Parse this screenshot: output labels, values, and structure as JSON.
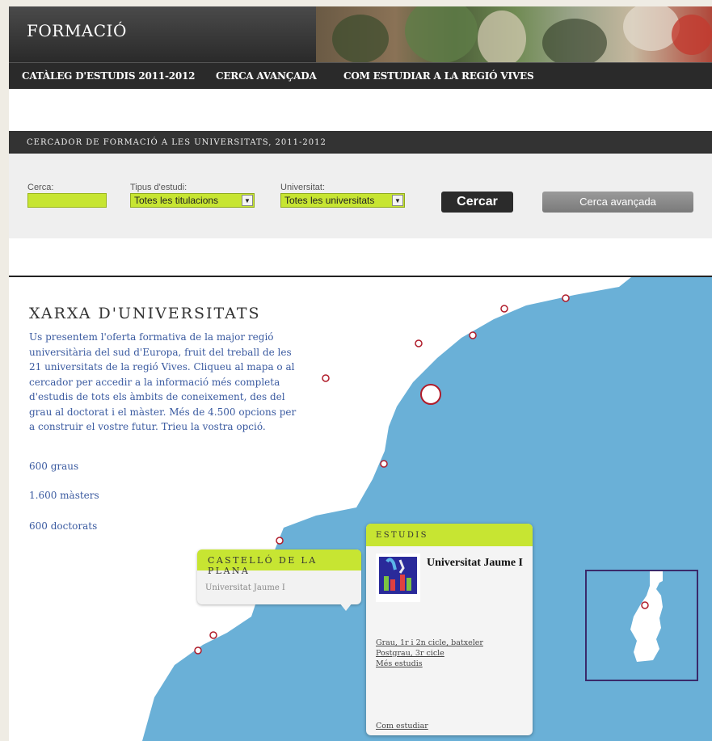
{
  "header": {
    "title": "FORMACIÓ"
  },
  "nav": {
    "items": [
      "CATÀLEG D'ESTUDIS 2011-2012",
      "CERCA AVANÇADA",
      "COM ESTUDIAR A LA REGIÓ VIVES"
    ]
  },
  "search": {
    "bar_title": "CERCADOR DE FORMACIÓ A LES UNIVERSITATS, 2011-2012",
    "search_label": "Cerca:",
    "type_label": "Tipus d'estudi:",
    "type_value": "Totes les titulacions",
    "university_label": "Universitat:",
    "university_value": "Totes les universitats",
    "search_button": "Cercar",
    "advanced_button": "Cerca avançada"
  },
  "map_intro": {
    "title": "XARXA D'UNIVERSITATS",
    "text": "Us presentem l'oferta formativa de la major regió universitària del sud d'Europa, fruit del treball de les 21 universitats de la regió Vives. Cliqueu al mapa o al cercador per accedir a la informació més completa d'estudis de tots els àmbits de coneixement, des del grau al doctorat i el màster. Més de 4.500 opcions per a construir el vostre futur. Trieu la vostra opció.",
    "stats": [
      "600 graus",
      "1.600 màsters",
      "600 doctorats"
    ]
  },
  "city_popup": {
    "title": "CASTELLÓ DE LA PLANA",
    "university": "Universitat Jaume I"
  },
  "studies_card": {
    "title": "ESTUDIS",
    "university_name": "Universitat Jaume I",
    "links": [
      "Grau, 1r i 2n cicle, batxeler",
      "Postgrau, 3r cicle",
      "Més estudis"
    ],
    "how_to_study": "Com estudiar"
  },
  "colors": {
    "accent": "#c7e532",
    "sea": "#6ab0d7",
    "dark": "#2a2a2a",
    "link": "#3a5aa0",
    "marker": "#b01c2a"
  }
}
